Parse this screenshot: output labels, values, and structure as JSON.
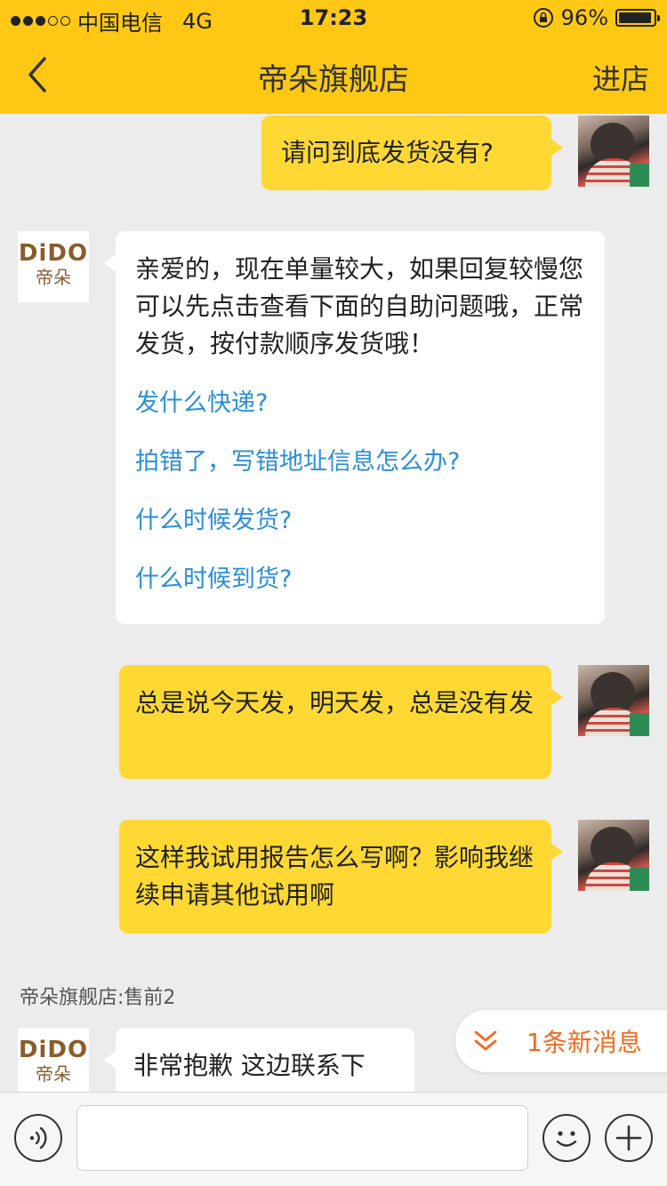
{
  "status_bar": {
    "carrier": "中国电信",
    "network": "4G",
    "time": "17:23",
    "battery": "96%",
    "battery_level": 0.96
  },
  "nav": {
    "back_icon": "chevron-left-icon",
    "title": "帝朵旗舰店",
    "right_action": "进店"
  },
  "shop": {
    "logo_text": "DiDO",
    "logo_cn": "帝朵"
  },
  "messages": [
    {
      "from": "user",
      "text": "请问到底发货没有?"
    },
    {
      "from": "shop",
      "text": "亲爱的，现在单量较大，如果回复较慢您可以先点击查看下面的自助问题哦，正常发货，按付款顺序发货哦！",
      "links": [
        "发什么快递?",
        "拍错了，写错地址信息怎么办?",
        "什么时候发货?",
        "什么时候到货?"
      ]
    },
    {
      "from": "user",
      "text": "总是说今天发，明天发，总是没有发"
    },
    {
      "from": "user",
      "text": "这样我试用报告怎么写啊？影响我继续申请其他试用啊"
    },
    {
      "from": "shop",
      "sender_name": "帝朵旗舰店:售前2",
      "text": "非常抱歉 这边联系下"
    }
  ],
  "new_message_pill": {
    "icon": "double-chevron-down-icon",
    "text": "1条新消息"
  },
  "input_bar": {
    "voice_icon": "voice-icon",
    "emoji_icon": "emoji-icon",
    "plus_icon": "plus-icon",
    "placeholder": ""
  },
  "colors": {
    "brand_yellow": "#ffc814",
    "bubble_yellow": "#ffd834",
    "link_blue": "#2a8fd8",
    "alert_orange": "#f06b21"
  }
}
